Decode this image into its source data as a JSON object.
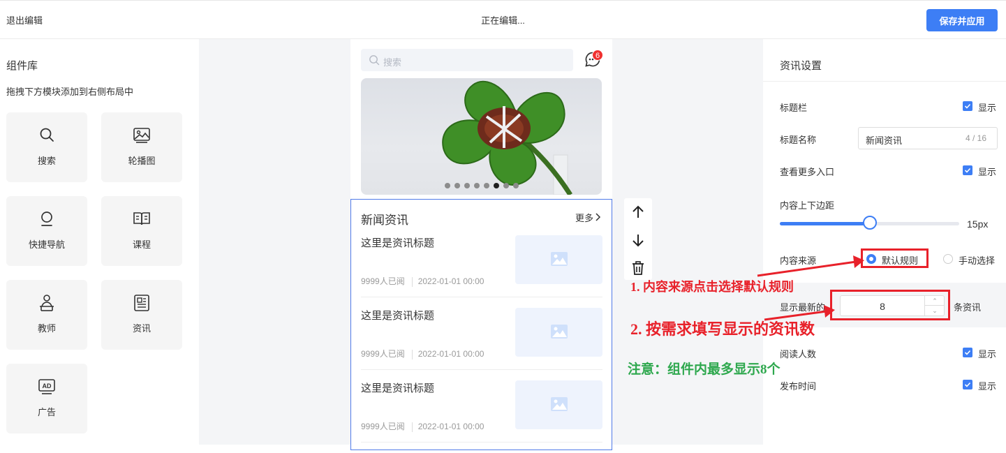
{
  "topbar": {
    "exit_label": "退出编辑",
    "status": "正在编辑...",
    "save_label": "保存并应用"
  },
  "library": {
    "title": "组件库",
    "subtitle": "拖拽下方模块添加到右侧布局中",
    "items": [
      {
        "label": "搜索",
        "icon": "search-icon"
      },
      {
        "label": "轮播图",
        "icon": "image-icon"
      },
      {
        "label": "快捷导航",
        "icon": "nav-icon"
      },
      {
        "label": "课程",
        "icon": "book-icon"
      },
      {
        "label": "教师",
        "icon": "teacher-icon"
      },
      {
        "label": "资讯",
        "icon": "newspaper-icon"
      },
      {
        "label": "广告",
        "icon": "ad-icon"
      }
    ]
  },
  "preview": {
    "search_placeholder": "搜索",
    "message_badge": "6",
    "banner_dots": 8,
    "banner_active_dot": 6,
    "news": {
      "title": "新闻资讯",
      "more": "更多",
      "items": [
        {
          "title": "这里是资讯标题",
          "reads": "9999人已阅",
          "time": "2022-01-01 00:00"
        },
        {
          "title": "这里是资讯标题",
          "reads": "9999人已阅",
          "time": "2022-01-01 00:00"
        },
        {
          "title": "这里是资讯标题",
          "reads": "9999人已阅",
          "time": "2022-01-01 00:00"
        }
      ]
    }
  },
  "settings": {
    "title": "资讯设置",
    "title_bar_label": "标题栏",
    "show_label": "显示",
    "title_name_label": "标题名称",
    "title_name_value": "新闻资讯",
    "title_name_count": "4 / 16",
    "more_entry_label": "查看更多入口",
    "padding_label": "内容上下边距",
    "padding_value": "15px",
    "padding_fraction": 0.5,
    "source_label": "内容来源",
    "source_default": "默认规则",
    "source_manual": "手动选择",
    "latest_prefix": "显示最新的",
    "latest_value": "8",
    "latest_suffix": "条资讯",
    "read_count_label": "阅读人数",
    "publish_time_label": "发布时间"
  },
  "annotations": {
    "step1": "1. 内容来源点击选择默认规则",
    "step2": "2. 按需求填写显示的资讯数",
    "note": "注意：组件内最多显示8个"
  },
  "colors": {
    "accent": "#3d7ef5",
    "annotation_red": "#e8212a",
    "annotation_green": "#2ea84e"
  }
}
